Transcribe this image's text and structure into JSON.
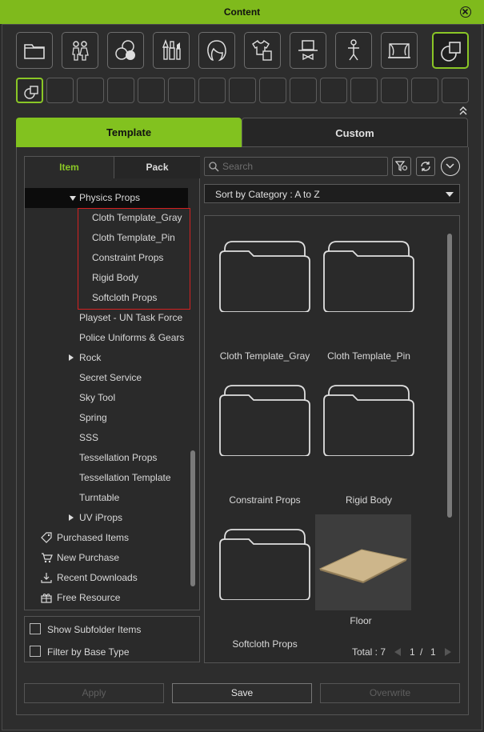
{
  "window": {
    "title": "Content"
  },
  "categories": [
    {
      "icon": "folder-icon"
    },
    {
      "icon": "avatar-pair-icon"
    },
    {
      "icon": "material-spheres-icon"
    },
    {
      "icon": "makeup-brushes-icon"
    },
    {
      "icon": "hair-icon"
    },
    {
      "icon": "clothing-icon"
    },
    {
      "icon": "accessory-icon"
    },
    {
      "icon": "motion-figure-icon"
    },
    {
      "icon": "stage-icon"
    },
    {
      "icon": "props-shapes-icon"
    }
  ],
  "main_tabs": {
    "template": "Template",
    "custom": "Custom"
  },
  "left_tabs": {
    "item": "Item",
    "pack": "Pack"
  },
  "tree": [
    {
      "label": "Physics Props",
      "level": 0,
      "arrow": "down",
      "selected": true
    },
    {
      "label": "Cloth Template_Gray",
      "level": 1
    },
    {
      "label": "Cloth Template_Pin",
      "level": 1
    },
    {
      "label": "Constraint Props",
      "level": 1
    },
    {
      "label": "Rigid Body",
      "level": 1
    },
    {
      "label": "Softcloth Props",
      "level": 1
    },
    {
      "label": "Playset - UN Task Force",
      "level": 0
    },
    {
      "label": "Police Uniforms & Gears",
      "level": 0
    },
    {
      "label": "Rock",
      "level": 0,
      "arrow": "right"
    },
    {
      "label": "Secret Service",
      "level": 0
    },
    {
      "label": "Sky Tool",
      "level": 0
    },
    {
      "label": "Spring",
      "level": 0
    },
    {
      "label": "SSS",
      "level": 0
    },
    {
      "label": "Tessellation Props",
      "level": 0
    },
    {
      "label": "Tessellation Template",
      "level": 0
    },
    {
      "label": "Turntable",
      "level": 0
    },
    {
      "label": "UV iProps",
      "level": 0,
      "arrow": "right"
    }
  ],
  "root_items": [
    {
      "label": "Purchased Items",
      "icon": "tag-icon"
    },
    {
      "label": "New Purchase",
      "icon": "cart-icon"
    },
    {
      "label": "Recent Downloads",
      "icon": "download-icon"
    },
    {
      "label": "Free Resource",
      "icon": "gift-icon"
    }
  ],
  "options": {
    "show_subfolder": "Show Subfolder Items",
    "filter_base": "Filter by Base Type"
  },
  "search": {
    "placeholder": "Search"
  },
  "sort": {
    "label": "Sort by Category : A to Z"
  },
  "items": [
    {
      "name": "Cloth Template_Gray",
      "type": "folder"
    },
    {
      "name": "Cloth Template_Pin",
      "type": "folder"
    },
    {
      "name": "Constraint Props",
      "type": "folder"
    },
    {
      "name": "Rigid Body",
      "type": "folder"
    },
    {
      "name": "Softcloth Props",
      "type": "folder"
    },
    {
      "name": "Floor",
      "type": "thumbnail"
    }
  ],
  "pager": {
    "total": "Total : 7",
    "page": "1",
    "sep": "/",
    "pages": "1"
  },
  "buttons": {
    "apply": "Apply",
    "save": "Save",
    "overwrite": "Overwrite"
  },
  "colors": {
    "accent": "#82c21f",
    "highlight_border": "#d42020"
  }
}
